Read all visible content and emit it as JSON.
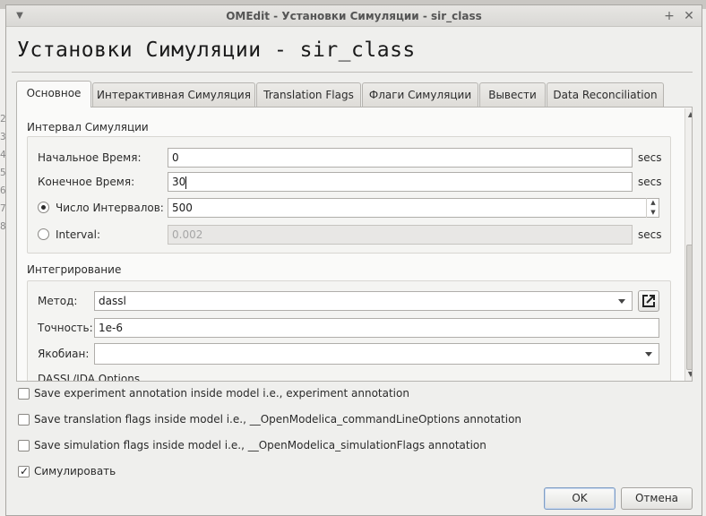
{
  "window": {
    "title": "OMEdit - Установки Симуляции - sir_class"
  },
  "heading": "Установки Симуляции - sir_class",
  "tabs": [
    {
      "label": "Основное"
    },
    {
      "label": "Интерактивная Симуляция"
    },
    {
      "label": "Translation Flags"
    },
    {
      "label": "Флаги Симуляции"
    },
    {
      "label": "Вывести"
    },
    {
      "label": "Data Reconciliation"
    }
  ],
  "interval": {
    "title": "Интервал Симуляции",
    "start_label": "Начальное Время:",
    "start_value": "0",
    "stop_label": "Конечное Время:",
    "stop_value": "30",
    "num_intervals_label": "Число Интервалов:",
    "num_intervals_value": "500",
    "interval_label": "Interval:",
    "interval_value": "0.002",
    "unit": "secs"
  },
  "integration": {
    "title": "Интегрирование",
    "method_label": "Метод:",
    "method_value": "dassl",
    "tolerance_label": "Точность:",
    "tolerance_value": "1e-6",
    "jacobian_label": "Якобиан:",
    "jacobian_value": "",
    "dassl_options_label": "DASSL/IDA Options"
  },
  "options": {
    "save_experiment": "Save experiment annotation inside model i.e., experiment annotation",
    "save_translation": "Save translation flags inside model i.e., __OpenModelica_commandLineOptions annotation",
    "save_simulation": "Save simulation flags inside model i.e., __OpenModelica_simulationFlags annotation",
    "simulate": "Симулировать",
    "simulate_checked": true
  },
  "buttons": {
    "ok": "OK",
    "cancel": "Отмена"
  },
  "background_gutter": [
    "2",
    "3",
    "4",
    "5",
    "6",
    "7",
    "8"
  ]
}
